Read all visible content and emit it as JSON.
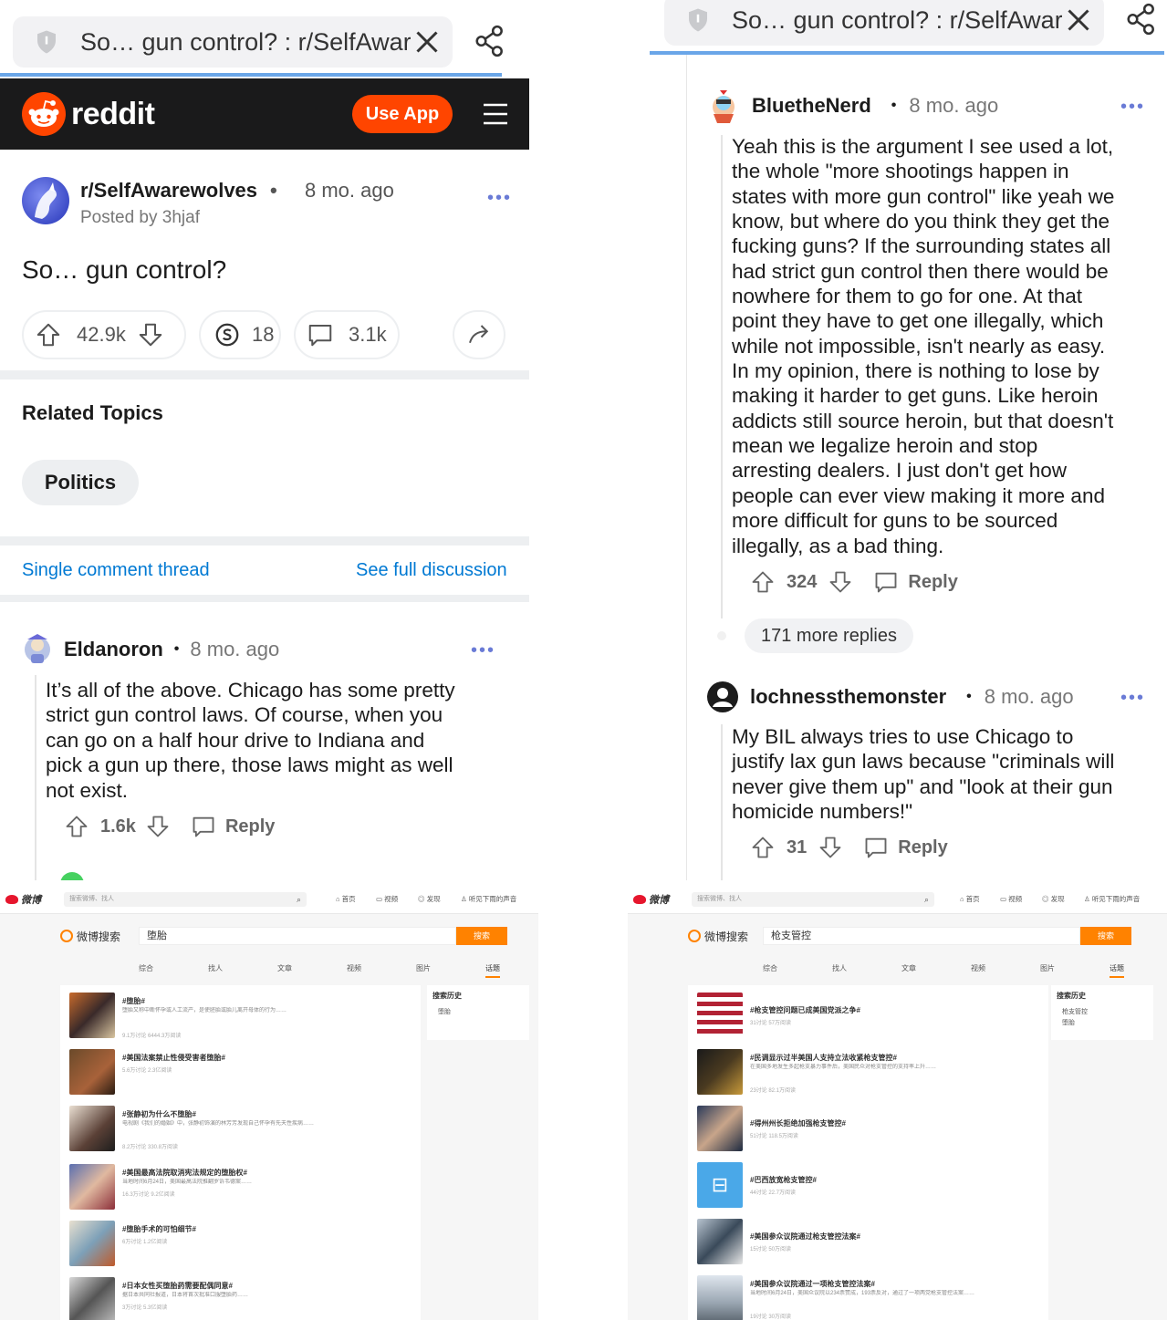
{
  "left_phone": {
    "tab_title": "So… gun control? : r/SelfAwar",
    "brand": "reddit",
    "use_app": "Use App",
    "post": {
      "subreddit": "r/SelfAwarewolves",
      "time": "8 mo. ago",
      "posted_by": "Posted by 3hjaf",
      "title": "So… gun control?",
      "upvotes": "42.9k",
      "awards": "18",
      "comments": "3.1k"
    },
    "related_topics_title": "Related Topics",
    "topic_chip": "Politics",
    "single_thread": "Single comment thread",
    "full_discussion": "See full discussion",
    "comment": {
      "user": "Eldanoron",
      "time": "8 mo. ago",
      "lines": [
        "It’s all of the above. Chicago has some pretty",
        "strict gun control laws. Of course, when you",
        "can go on a half hour drive to Indiana and",
        "pick a gun up there, those laws might as well",
        "not exist."
      ],
      "votes": "1.6k",
      "reply": "Reply"
    }
  },
  "right_phone": {
    "tab_title": "So… gun control? : r/SelfAwar",
    "comment1": {
      "user": "BluetheNerd",
      "time": "8 mo. ago",
      "lines": [
        "Yeah this is the argument I see used a lot,",
        "the whole \"more shootings happen in",
        "states with more gun control\" like yeah we",
        "know, but where do you think they get the",
        "fucking guns? If the surrounding states all",
        "had strict gun control then there would be",
        "nowhere for them to go for one. At that",
        "point they have to get one illegally, which",
        "while not impossible, isn't nearly as easy.",
        "In my opinion, there is nothing to lose by",
        "making it harder to get guns. Like heroin",
        "addicts still source heroin, but that doesn't",
        "mean we legalize heroin and stop",
        "arresting dealers. I just don't get how",
        "people can ever view making it more and",
        "more difficult for guns to be sourced",
        "illegally, as a bad thing."
      ],
      "votes": "324",
      "reply": "Reply"
    },
    "more_replies": "171 more replies",
    "comment2": {
      "user": "lochnessthemonster",
      "time": "8 mo. ago",
      "lines": [
        "My BIL always tries to use Chicago to",
        "justify lax gun laws because \"criminals will",
        "never give them up\" and \"look at their gun",
        "homicide numbers!\""
      ],
      "votes": "31",
      "reply": "Reply"
    }
  },
  "weibo_left": {
    "logo": "微博",
    "top_search_placeholder": "搜索微博、找人",
    "nav": [
      "首页",
      "视频",
      "发现",
      "听见下雨的声音"
    ],
    "brand": "微博搜索",
    "query": "堕胎",
    "search_button": "搜索",
    "tabs": [
      "综合",
      "找人",
      "文章",
      "视频",
      "图片",
      "话题"
    ],
    "side_title": "搜索历史",
    "side_items": [
      "堕胎"
    ],
    "items": [
      {
        "title": "#堕胎#",
        "desc": "堕胎又称中断怀孕或人工流产，是使胚胎或胎儿离开母体的行为……",
        "meta": "9.1万讨论 6444.3万阅读"
      },
      {
        "title": "#美国法案禁止性侵受害者堕胎#",
        "desc": "",
        "meta": "5.6万讨论 2.3亿阅读"
      },
      {
        "title": "#张静初为什么不堕胎#",
        "desc": "电视剧《我们的婚姻》中，张静初饰演的林芳芳发现自己怀孕有先天性疾病……",
        "meta": "8.2万讨论 330.8万阅读"
      },
      {
        "title": "#美国最高法院取消宪法规定的堕胎权#",
        "desc": "当地时间6月24日，美国最高法院推翻罗诉韦德案……",
        "meta": "16.3万讨论 9.2亿阅读"
      },
      {
        "title": "#堕胎手术的可怕细节#",
        "desc": "",
        "meta": "6万讨论 1.2亿阅读"
      },
      {
        "title": "#日本女性买堕胎药需要配偶同意#",
        "desc": "据日本共同社报道，日本将首次批准口服堕胎药……",
        "meta": "3万讨论 5.3亿阅读"
      }
    ]
  },
  "weibo_right": {
    "logo": "微博",
    "top_search_placeholder": "搜索微博、找人",
    "nav": [
      "首页",
      "视频",
      "发现",
      "听见下雨的声音"
    ],
    "brand": "微博搜索",
    "query": "枪支管控",
    "search_button": "搜索",
    "tabs": [
      "综合",
      "找人",
      "文章",
      "视频",
      "图片",
      "话题"
    ],
    "side_title": "搜索历史",
    "side_items": [
      "枪支管控",
      "堕胎"
    ],
    "items": [
      {
        "title": "#枪支管控问题已成美国党派之争#",
        "desc": "",
        "meta": "31讨论 57万阅读"
      },
      {
        "title": "#民调显示过半美国人支持立法收紧枪支管控#",
        "desc": "在美国多地发生多起枪支暴力事件后，美国民众对枪支管控的支持率上升……",
        "meta": "23讨论 82.1万阅读"
      },
      {
        "title": "#得州州长拒绝加强枪支管控#",
        "desc": "",
        "meta": "51讨论 118.5万阅读"
      },
      {
        "title": "#巴西放宽枪支管控#",
        "desc": "",
        "meta": "44讨论 22.7万阅读"
      },
      {
        "title": "#美国参众议院通过枪支管控法案#",
        "desc": "",
        "meta": "15讨论 50万阅读"
      },
      {
        "title": "#美国参众议院通过一项枪支管控法案#",
        "desc": "当地时间6月24日，美国众议院以234票赞成，193票反对，通过了一项两党枪支管控法案……",
        "meta": "19讨论 30万阅读"
      }
    ]
  },
  "colors": {
    "reddit_orange": "#ff4500",
    "reddit_blue": "#0079d3",
    "weibo_orange": "#ff8200"
  }
}
